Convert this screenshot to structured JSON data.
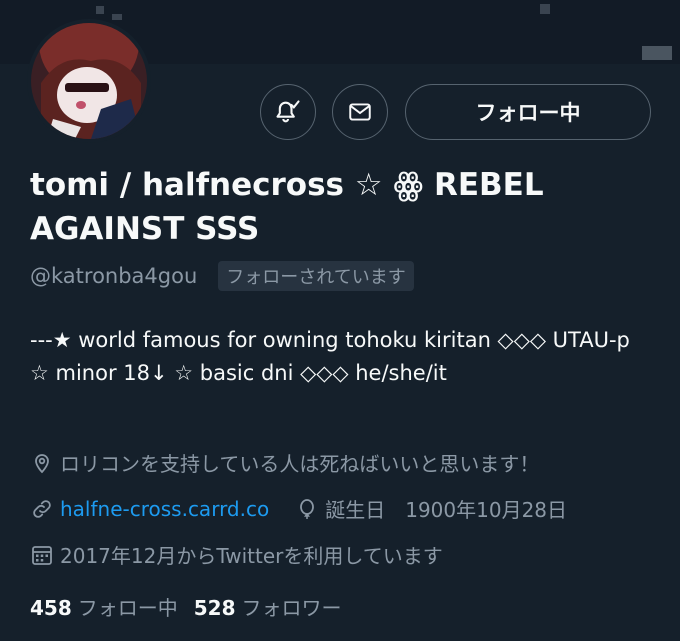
{
  "profile": {
    "display_name": "tomi / halfnecross ☆ ꙮ REBEL AGAINST SSS",
    "handle": "@katronba4gou",
    "follows_you": "フォローされています",
    "bio": "---★ world famous for owning tohoku kiritan ◇◇◇ UTAU-p ☆ minor 18↓ ☆ basic dni ◇◇◇ he/she/it",
    "location": "ロリコンを支持している人は死ねばいいと思います！",
    "website": "halfne-cross.carrd.co",
    "birthday": "誕生日　1900年10月28日",
    "joined": "2017年12月からTwitterを利用しています"
  },
  "actions": {
    "follow_label": "フォロー中",
    "notification_icon": "bell-check-icon",
    "message_icon": "envelope-icon"
  },
  "stats": {
    "following_count": "458",
    "following_label": "フォロー中",
    "followers_count": "528",
    "followers_label": "フォロワー"
  },
  "colors": {
    "background": "#15202b",
    "text": "#f7f9f9",
    "muted": "#8b98a5",
    "link": "#1d9bf0",
    "border": "#56636f"
  }
}
